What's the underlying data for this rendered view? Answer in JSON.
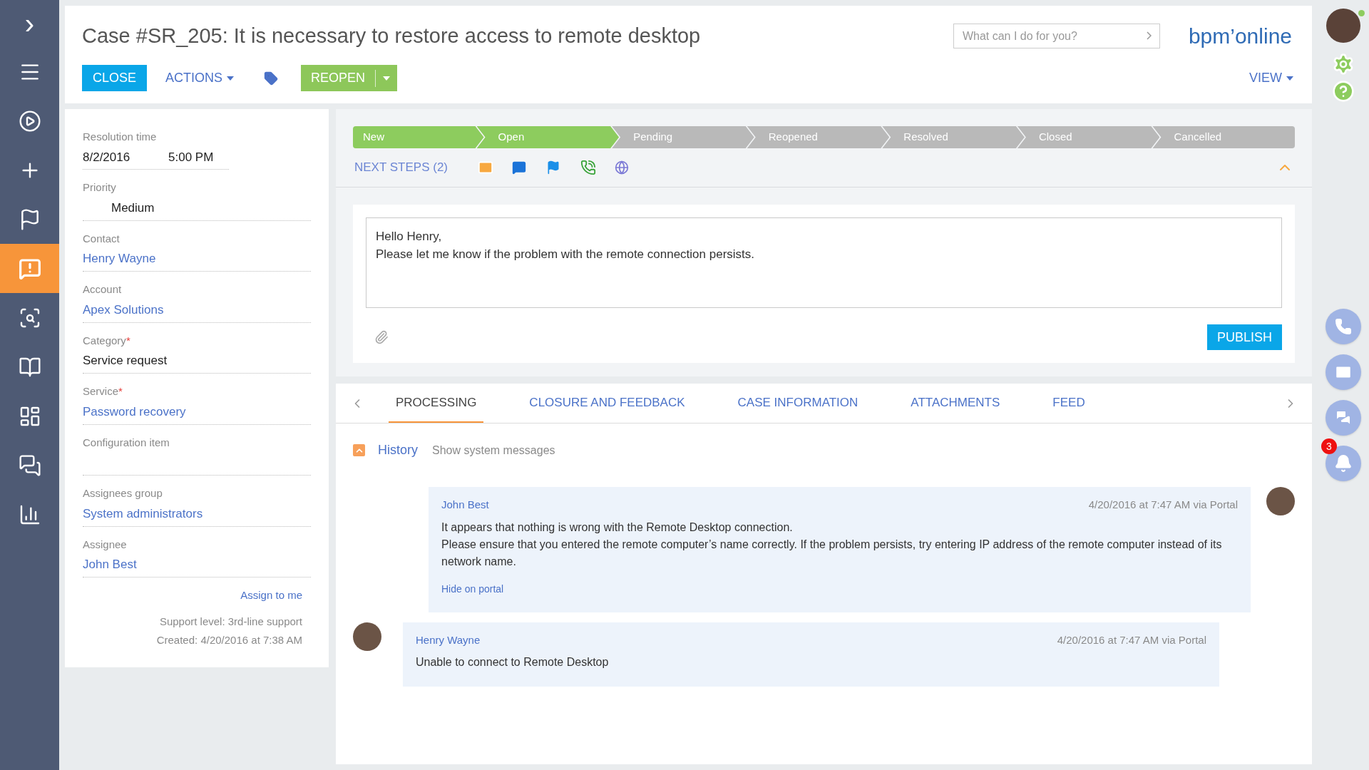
{
  "sidebar": {
    "expand": "›",
    "items": [
      {
        "kind": "menu",
        "selected": false
      },
      {
        "kind": "play",
        "selected": false
      },
      {
        "kind": "plus",
        "selected": false
      },
      {
        "kind": "flag",
        "selected": false
      },
      {
        "kind": "alert",
        "selected": true
      },
      {
        "kind": "search",
        "selected": false
      },
      {
        "kind": "book",
        "selected": false
      },
      {
        "kind": "dashboard",
        "selected": false
      },
      {
        "kind": "chat",
        "selected": false
      },
      {
        "kind": "chart",
        "selected": false
      }
    ]
  },
  "header": {
    "title": "Case #SR_205: It is necessary to restore access to remote desktop",
    "search": {
      "placeholder": "What can I do for you?"
    },
    "logo": "bpm’online",
    "buttons": {
      "close": "CLOSE",
      "actions": "ACTIONS",
      "reopen": "REOPEN",
      "view": "VIEW"
    }
  },
  "details": {
    "fields": [
      {
        "label": "Resolution time",
        "kind": "datetime",
        "values": [
          "8/2/2016",
          "5:00 PM"
        ]
      },
      {
        "label": "Priority",
        "kind": "select",
        "value": "Medium"
      },
      {
        "label": "Contact",
        "kind": "link",
        "value": "Henry Wayne"
      },
      {
        "label": "Account",
        "kind": "link",
        "value": "Apex Solutions"
      },
      {
        "label": "Category",
        "required_mark": "*",
        "kind": "text",
        "value": "Service request"
      },
      {
        "label": "Service",
        "required_mark": "*",
        "kind": "link",
        "value": "Password recovery"
      },
      {
        "label": "Configuration item",
        "kind": "text"
      },
      {
        "label": "Assignees group",
        "kind": "link",
        "value": "System administrators"
      },
      {
        "label": "Assignee",
        "kind": "link",
        "value": "John Best"
      }
    ],
    "assign_link": "Assign to me",
    "support_level": "Support level: 3rd-line support",
    "created": "Created: 4/20/2016 at 7:38 AM"
  },
  "stages": [
    {
      "label": "New",
      "completed": true
    },
    {
      "label": "Open",
      "completed": true
    },
    {
      "label": "Pending",
      "completed": false
    },
    {
      "label": "Reopened",
      "completed": false
    },
    {
      "label": "Resolved",
      "completed": false
    },
    {
      "label": "Closed",
      "completed": false
    },
    {
      "label": "Cancelled",
      "completed": false
    }
  ],
  "next_steps": {
    "label": "NEXT STEPS (2)"
  },
  "composer": {
    "value": "Hello Henry,\nPlease let me know if the problem with the remote connection persists.",
    "publish": "PUBLISH"
  },
  "tabs": [
    {
      "label": "PROCESSING",
      "selected": true
    },
    {
      "label": "CLOSURE AND FEEDBACK",
      "selected": false
    },
    {
      "label": "CASE INFORMATION",
      "selected": false
    },
    {
      "label": "ATTACHMENTS",
      "selected": false
    },
    {
      "label": "FEED",
      "selected": false
    }
  ],
  "history": {
    "title": "History",
    "expanded": true,
    "system_messages": "Show system messages"
  },
  "messages": [
    {
      "author": "John Best",
      "time": "4/20/2016 at 7:47 AM via Portal",
      "kind": "staff",
      "body": [
        "It appears that nothing is wrong with the Remote Desktop connection.",
        "Please ensure that you entered the remote computer’s name correctly. If the problem persists, try entering IP address of the remote computer instead of its network name."
      ],
      "link": "Hide on portal"
    },
    {
      "author": "Henry Wayne",
      "time": "4/20/2016 at 7:47 AM via Portal",
      "kind": "customer",
      "body": [
        "Unable to connect to Remote Desktop"
      ]
    }
  ],
  "right_rail": {
    "online": true,
    "notifications": "3"
  }
}
